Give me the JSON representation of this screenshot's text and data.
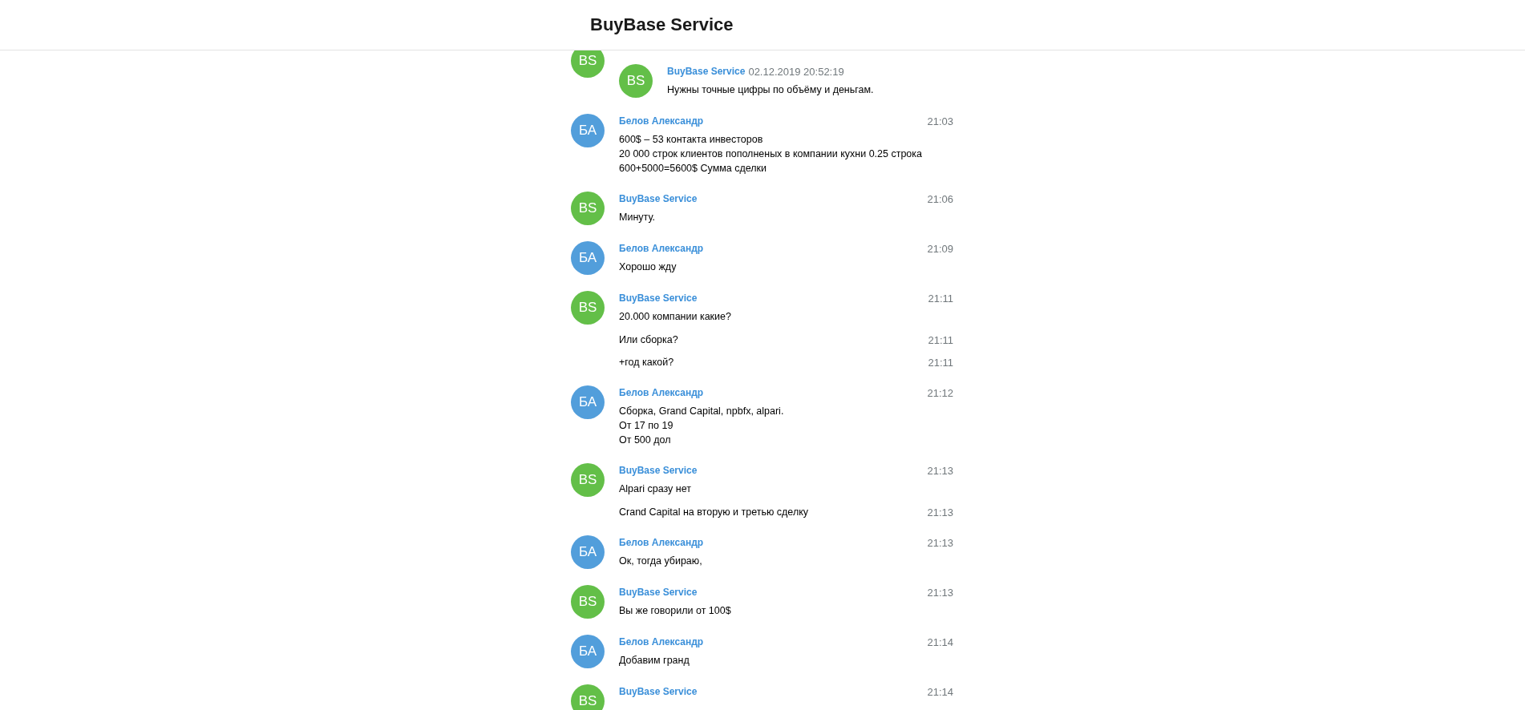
{
  "header": {
    "title": "BuyBase Service"
  },
  "messages": [
    {
      "kind": "forwarded",
      "avatar": {
        "initials": "BS",
        "color": "#63bf48"
      },
      "forwarded": {
        "avatar": {
          "initials": "BS",
          "color": "#63bf48"
        },
        "sender": "BuyBase Service",
        "date": "02.12.2019 20:52:19",
        "text": "Нужны точные цифры по объёму и деньгам."
      }
    },
    {
      "kind": "message",
      "avatar": {
        "initials": "БА",
        "color": "#529edb"
      },
      "sender": "Белов Александр",
      "time": "21:03",
      "text": "600$ – 53 контакта инвесторов\n20 000 строк клиентов пополненых в компании кухни 0.25 строка\n600+5000=5600$ Сумма сделки"
    },
    {
      "kind": "message",
      "avatar": {
        "initials": "BS",
        "color": "#63bf48"
      },
      "sender": "BuyBase Service",
      "time": "21:06",
      "text": "Минуту."
    },
    {
      "kind": "message",
      "avatar": {
        "initials": "БА",
        "color": "#529edb"
      },
      "sender": "Белов Александр",
      "time": "21:09",
      "text": "Хорошо жду"
    },
    {
      "kind": "message",
      "avatar": {
        "initials": "BS",
        "color": "#63bf48"
      },
      "sender": "BuyBase Service",
      "time": "21:11",
      "text": "20.000 компании какие?"
    },
    {
      "kind": "joined",
      "time": "21:11",
      "text": "Или сборка?"
    },
    {
      "kind": "joined",
      "time": "21:11",
      "text": "+год какой?"
    },
    {
      "kind": "message",
      "avatar": {
        "initials": "БА",
        "color": "#529edb"
      },
      "sender": "Белов Александр",
      "time": "21:12",
      "text": "Сборка, Grand Capital, npbfx, alpari.\nОт 17 по 19\nОт 500 дол"
    },
    {
      "kind": "message",
      "avatar": {
        "initials": "BS",
        "color": "#63bf48"
      },
      "sender": "BuyBase Service",
      "time": "21:13",
      "text": "Alpari сразу нет"
    },
    {
      "kind": "joined",
      "time": "21:13",
      "text": "Crand Capital на вторую и третью сделку"
    },
    {
      "kind": "message",
      "avatar": {
        "initials": "БА",
        "color": "#529edb"
      },
      "sender": "Белов Александр",
      "time": "21:13",
      "text": "Ок, тогда убираю,"
    },
    {
      "kind": "message",
      "avatar": {
        "initials": "BS",
        "color": "#63bf48"
      },
      "sender": "BuyBase Service",
      "time": "21:13",
      "text": "Вы же говорили от 100$"
    },
    {
      "kind": "message",
      "avatar": {
        "initials": "БА",
        "color": "#529edb"
      },
      "sender": "Белов Александр",
      "time": "21:14",
      "text": "Добавим гранд"
    },
    {
      "kind": "message",
      "avatar": {
        "initials": "BS",
        "color": "#63bf48"
      },
      "sender": "BuyBase Service",
      "time": "21:14"
    }
  ]
}
